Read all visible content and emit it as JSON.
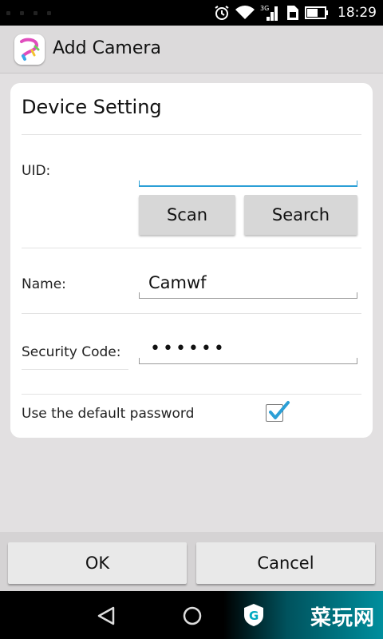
{
  "status_bar": {
    "time": "18:29",
    "network_type": "3G",
    "icons": [
      "alarm-icon",
      "wifi-icon",
      "signal-icon",
      "sim-icon",
      "battery-icon"
    ]
  },
  "action_bar": {
    "title": "Add Camera",
    "app_icon": "app-logo-icon"
  },
  "card": {
    "title": "Device Setting",
    "uid": {
      "label": "UID:",
      "value": ""
    },
    "scan_label": "Scan",
    "search_label": "Search",
    "name": {
      "label": "Name:",
      "value": "Camwf"
    },
    "security": {
      "label": "Security Code:",
      "value": "••••••"
    },
    "default_password": {
      "label": "Use the default password",
      "checked": true
    }
  },
  "buttons": {
    "ok": "OK",
    "cancel": "Cancel"
  },
  "nav": {
    "icons": [
      "back-icon",
      "home-icon"
    ]
  },
  "watermark": {
    "text": "菜玩网"
  },
  "colors": {
    "accent": "#2b9fd6",
    "card_bg": "#ffffff",
    "page_bg": "#e2e0e1",
    "watermark": "#00bed2"
  }
}
